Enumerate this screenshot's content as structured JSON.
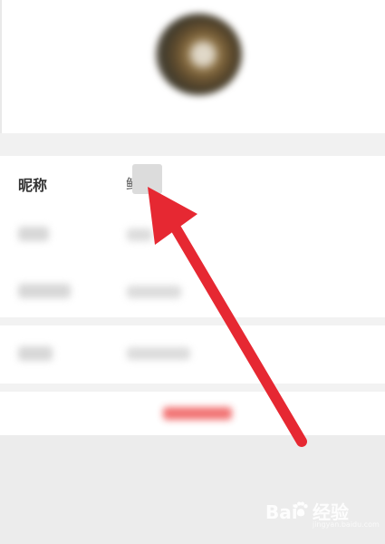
{
  "profile": {
    "nickname_label": "昵称",
    "nickname_value_prefix": "鲜"
  },
  "watermark": {
    "brand_left": "Bai",
    "brand_right": "经验",
    "brand_sub": "jingyan.baidu.com"
  },
  "colors": {
    "arrow": "#e62832",
    "logout_blur": "#f16b6b",
    "card": "#ffffff",
    "background": "#ececec"
  },
  "icons": {
    "watermark_mark": "paw-icon"
  }
}
